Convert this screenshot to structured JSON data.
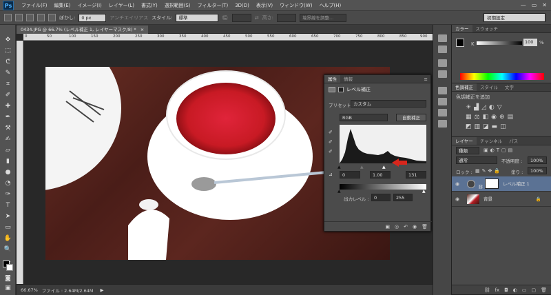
{
  "app": {
    "logo": "Ps"
  },
  "menu": [
    "ファイル(F)",
    "編集(E)",
    "イメージ(I)",
    "レイヤー(L)",
    "書式(Y)",
    "選択範囲(S)",
    "フィルター(T)",
    "3D(D)",
    "表示(V)",
    "ウィンドウ(W)",
    "ヘルプ(H)"
  ],
  "window_controls": [
    "—",
    "▭",
    "✕"
  ],
  "options": {
    "feather_label": "ぼかし:",
    "feather_value": "0 px",
    "antialias_label": "アンチエイリアス",
    "style_label": "スタイル:",
    "style_value": "標準",
    "width_label": "幅:",
    "height_label": "高さ:",
    "refine_edge": "境界線を調整...",
    "workspace": "初期設定"
  },
  "document": {
    "tab_title": "0434.JPG @ 66.7% (レベル補正 1, レイヤーマスク/8) *",
    "tab_close": "×",
    "ruler_ticks": [
      "0",
      "50",
      "100",
      "150",
      "200",
      "250",
      "300",
      "350",
      "400",
      "450",
      "500",
      "550",
      "600",
      "650",
      "700",
      "750",
      "800",
      "850",
      "900"
    ],
    "status": "ファイル : 2.64M/2.64M",
    "zoom": "66.67%"
  },
  "properties_panel": {
    "tabs": [
      "属性",
      "情報"
    ],
    "title": "レベル補正",
    "preset_label": "プリセット :",
    "preset_value": "カスタム",
    "channel": "RGB",
    "auto_button": "自動補正",
    "input_black": "0",
    "input_gamma": "1.00",
    "input_white": "131",
    "output_label": "出力レベル :",
    "output_black": "0",
    "output_white": "255"
  },
  "color_panel": {
    "tabs": [
      "カラー",
      "スウォッチ"
    ],
    "channel_label": "K",
    "value": "100",
    "unit": "%"
  },
  "adjustments_panel": {
    "tabs": [
      "色調補正",
      "スタイル",
      "文字"
    ],
    "add_label": "色調補正を追加"
  },
  "layers_panel": {
    "tabs": [
      "レイヤー",
      "チャンネル",
      "パス"
    ],
    "filter_kind": "種類",
    "blend_mode": "通常",
    "opacity_label": "不透明度 :",
    "opacity_value": "100%",
    "lock_label": "ロック :",
    "fill_label": "塗り :",
    "fill_value": "100%",
    "layers": [
      {
        "name": "レベル補正 1",
        "visible": true,
        "selected": true
      },
      {
        "name": "背景",
        "visible": true,
        "selected": false,
        "locked": true
      }
    ]
  },
  "colors": {
    "accent_red": "#d8261c",
    "selected_layer": "#5b7294",
    "panel_bg": "#4a4a4a"
  }
}
